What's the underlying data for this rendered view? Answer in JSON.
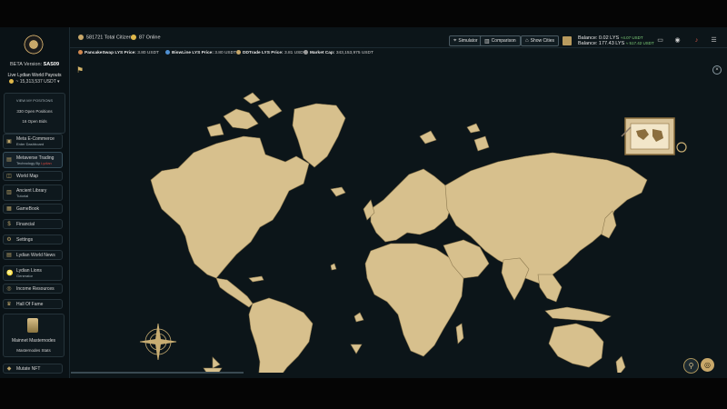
{
  "sidebar": {
    "beta_label": "BETA Version:",
    "beta_value": "SAS09",
    "payout_title": "Live Lydian World Payouts",
    "payout_value": "~ 15,313,537 USDT ▾",
    "positions": {
      "header": "VIEW MY POSITIONS",
      "open_positions": "330 Open Positions",
      "open_bids": "16 Open Bids"
    },
    "items": [
      {
        "label": "Meta E-Commerce",
        "sub": "Enter Dashboard",
        "icon": "cart-icon"
      },
      {
        "label": "Metaverse Trading",
        "sub": "Technology By",
        "sub_brand": "Lydian",
        "icon": "chart-icon"
      },
      {
        "label": "World Map",
        "icon": "map-icon"
      },
      {
        "label": "Ancient Library",
        "sub": "Tutorial",
        "icon": "book-icon"
      },
      {
        "label": "GameBook",
        "icon": "gamebook-icon"
      },
      {
        "label": "Financial",
        "icon": "money-icon"
      },
      {
        "label": "Settings",
        "icon": "gear-icon"
      },
      {
        "label": "Lydian World News",
        "icon": "news-icon"
      },
      {
        "label": "Lydian Lions",
        "sub": "Generator",
        "icon": "lion-icon"
      },
      {
        "label": "Income Resources",
        "icon": "coins-icon"
      },
      {
        "label": "Hall Of Fame",
        "icon": "trophy-icon"
      }
    ],
    "masternodes": {
      "title": "Mainnet Masternodes",
      "stats": "Masternodes Stats"
    },
    "mutate": "Mutate NFT"
  },
  "header": {
    "total_citizens": "581721 Total Citizens",
    "online": "87 Online",
    "simulator": "Simulator",
    "comparison": "Comparison",
    "show_cities": "Show Cities",
    "balance1": "Balance: 0.02 LYS",
    "balance1_change": "+4.07 USDT",
    "balance2": "Balance: 177.43 LYS",
    "balance2_change": "≈ 517.42 USDT"
  },
  "ticker": [
    {
      "name": "PancakeSwap LYS Price:",
      "value": "3.80 USDT",
      "color": "#d1884f"
    },
    {
      "name": "BiswLine LYS Price:",
      "value": "3.80 USDT",
      "color": "#4f8fd1"
    },
    {
      "name": "DDTrade LYS Price:",
      "value": "3.81 USDT",
      "color": "#c8a86a"
    },
    {
      "name": "Market Cap:",
      "value": "343,153,975 USDT",
      "color": "#9a9a9a"
    }
  ],
  "colors": {
    "land": "#d7c08d",
    "ocean": "#0c1519",
    "accent": "#c8a86a"
  }
}
